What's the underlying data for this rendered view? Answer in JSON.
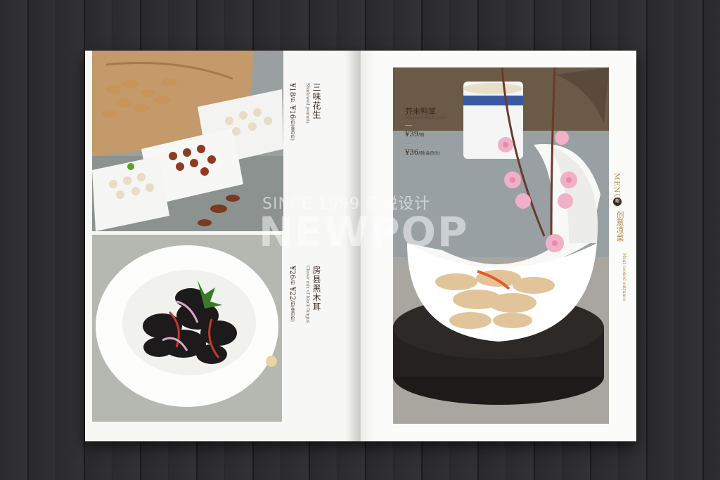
{
  "menu_left": {
    "dish1": {
      "name": "三味花生",
      "sub": "Shadowed peanuts",
      "price1": "¥18",
      "unit1": "/份",
      "price2": "¥16",
      "unit2": "/份(会员价)"
    },
    "dish2": {
      "name": "房县黑木耳",
      "sub": "Clever mix of black fungus",
      "price1": "¥26",
      "unit1": "/份",
      "price2": "¥22",
      "unit2": "/份(会员价)"
    }
  },
  "menu_right": {
    "dish": {
      "name": "芥末鸭掌",
      "sub": "Mustard duck palm",
      "price1": "¥39",
      "unit1": "/例",
      "price2": "¥36",
      "unit2": "/例(会员价)"
    },
    "side": {
      "menu": "MENU",
      "mark": "鲍",
      "category": "创意凉菜",
      "category_en": "Meat cooked entrance"
    }
  },
  "watermark": {
    "top": "SINCE 1999 新锐设计",
    "main": "NEWPOP"
  },
  "colors": {
    "background": "#2b2b2d",
    "page": "#f7f7f5",
    "accent_gold": "#b48a3c",
    "text_brown": "#3b2b1f"
  }
}
